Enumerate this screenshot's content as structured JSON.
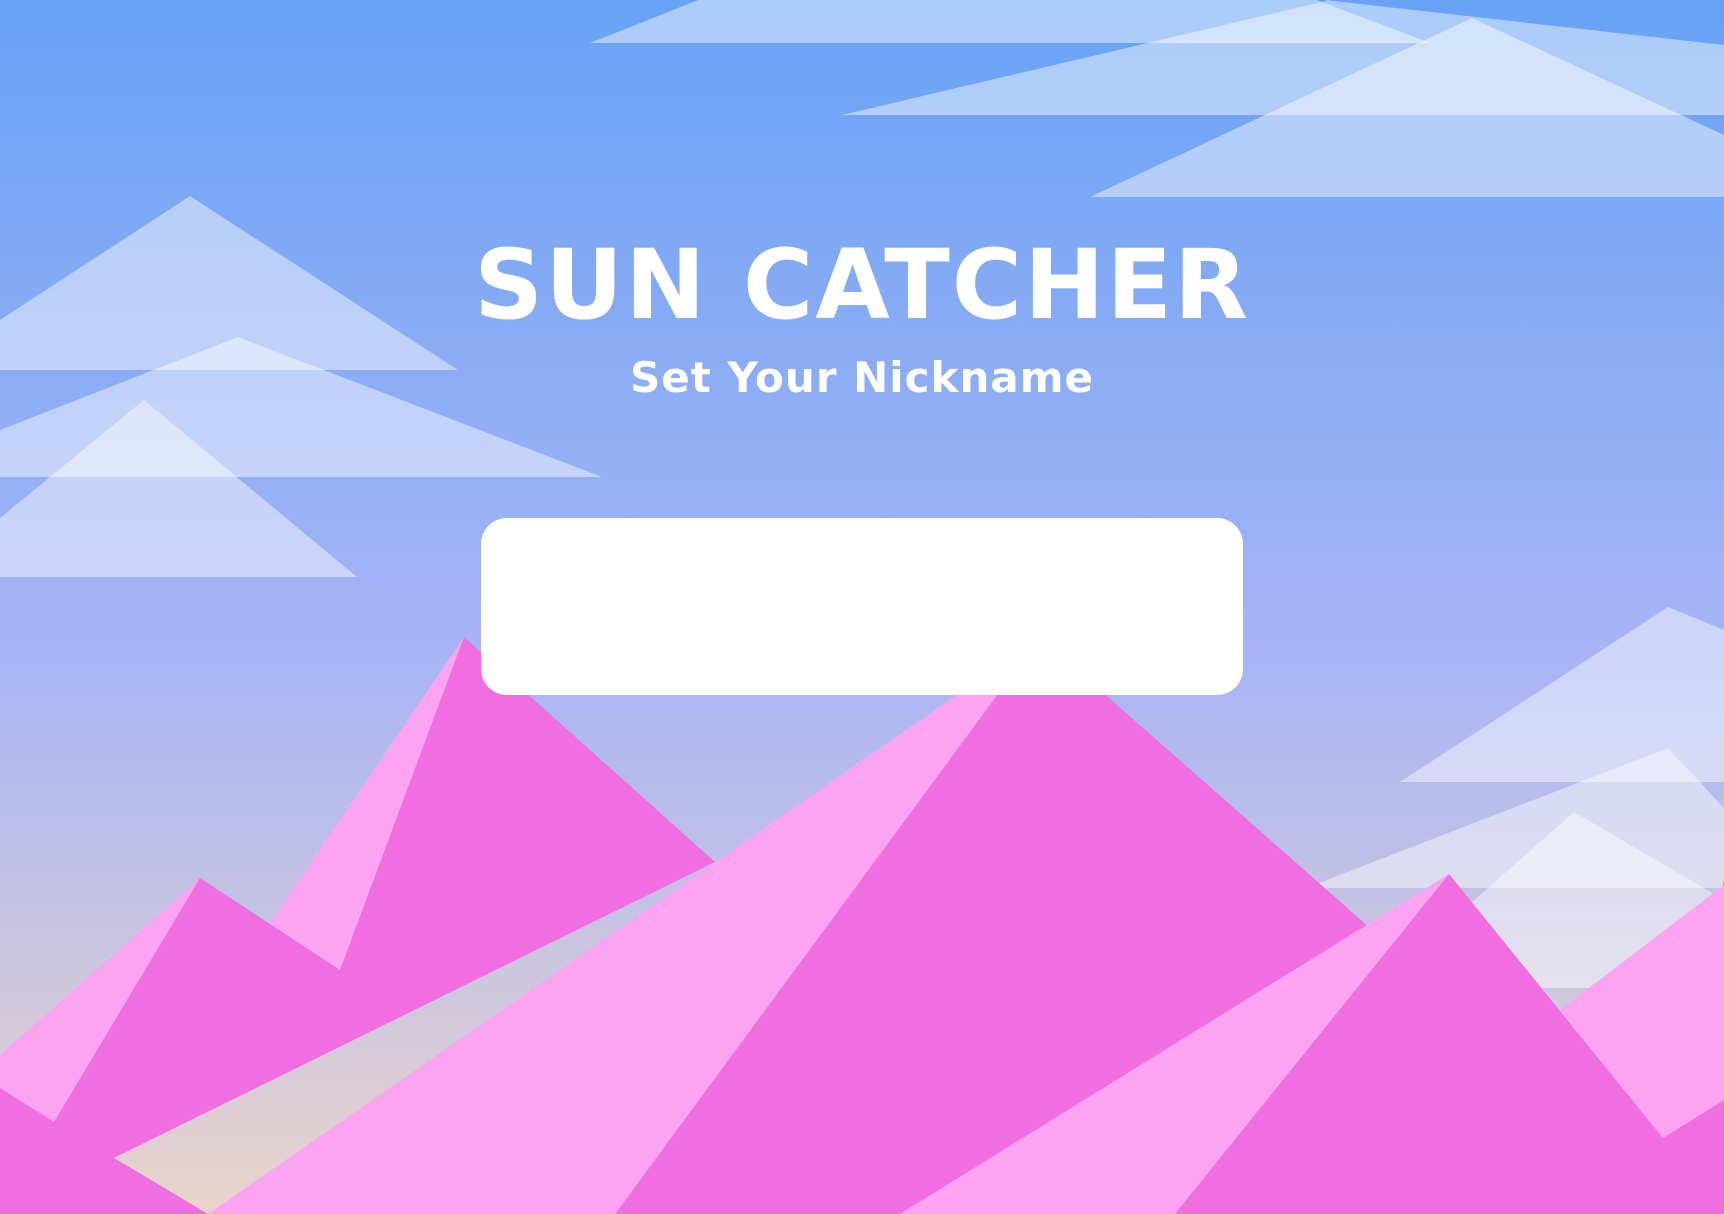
{
  "game": {
    "title": "SUN CATCHER",
    "subtitle": "Set Your Nickname"
  },
  "nickname_input": {
    "value": "",
    "placeholder": ""
  },
  "colors": {
    "sky_top": "#68a2f5",
    "sky_mid": "#a9b5f5",
    "sky_horizon": "#e9d4cc",
    "cloud": "#ffffff",
    "mountain_dark": "#f06ee0",
    "mountain_light": "#fca4f2",
    "text": "#ffffff"
  }
}
